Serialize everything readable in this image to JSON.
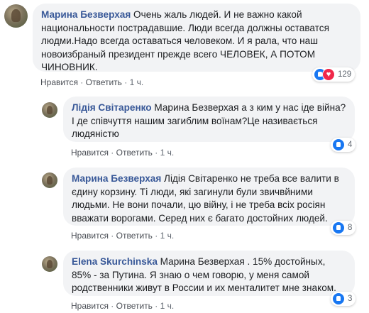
{
  "comments": [
    {
      "author": "Марина Безверхая",
      "text": "Очень жаль людей. И не важно какой национальности пострадавшие. Люди всегда должны оставатся людми.Надо всегда оставаться человеком. И я рала, что наш новоизбраный президент прежде всего ЧЕЛОВЕК, А ПОТОМ ЧИНОВНИК.",
      "like": "Нравится",
      "reply": "Ответить",
      "time": "1 ч.",
      "reactions": [
        "like-icon",
        "love-icon"
      ],
      "reaction_count": "129"
    },
    {
      "author": "Лідія Світаренко",
      "text": "Марина Безверхая а з ким у нас іде війна? І де співчуття нашим загиблим воїнам?Це називається людяністю",
      "like": "Нравится",
      "reply": "Ответить",
      "time": "1 ч.",
      "reactions": [
        "like-icon"
      ],
      "reaction_count": "4"
    },
    {
      "author": "Марина Безверхая",
      "text": "Лідія Світаренко не треба все валити в єдину корзину. Ті люди, які загинули були звичвйними людьми. Не вони почали, цю війну, і не треба всіх росіян вважати ворогами. Серед них є багато достойних людей.",
      "like": "Нравится",
      "reply": "Ответить",
      "time": "1 ч.",
      "reactions": [
        "like-icon"
      ],
      "reaction_count": "8"
    },
    {
      "author": "Elena Skurchinska",
      "text": "Марина Безверхая . 15% достойных, 85% - за Путина. Я знаю о чем говорю, у меня самой родственники живут в России и их менталитет мне знаком.",
      "like": "Нравится",
      "reply": "Ответить",
      "time": "1 ч.",
      "reactions": [
        "like-icon"
      ],
      "reaction_count": "3"
    }
  ],
  "separator": " · ",
  "colors": {
    "author": "#385898",
    "bubble": "#f2f3f5",
    "like": "#1877f2",
    "love": "#f0284a"
  }
}
